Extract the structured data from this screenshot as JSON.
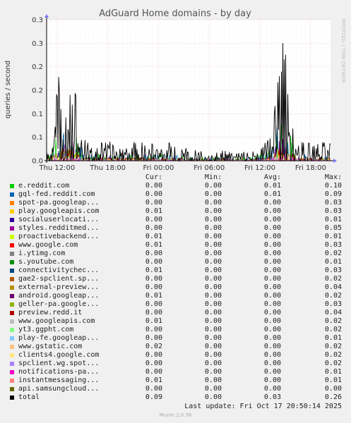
{
  "chart_data": {
    "type": "line",
    "title": "AdGuard Home domains - by day",
    "ylabel": "queries / second",
    "xlabel": "",
    "side_label": "RRDTOOL / TOBI OETIKER",
    "ylim": [
      0,
      0.3
    ],
    "yticks": [
      "0.0",
      "0.1",
      "0.1",
      "0.2",
      "0.2",
      "0.3",
      "0.3"
    ],
    "x_tick_labels": [
      "Thu 12:00",
      "Thu 18:00",
      "Fri 00:00",
      "Fri 06:00",
      "Fri 12:00",
      "Fri 18:00"
    ],
    "grid": true,
    "legend_header": [
      "Cur:",
      "Min:",
      "Avg:",
      "Max:"
    ],
    "series": [
      {
        "name": "e.reddit.com",
        "color": "#00cc00",
        "cur": "0.00",
        "min": "0.00",
        "avg": "0.01",
        "max": "0.10"
      },
      {
        "name": "gql-fed.reddit.com",
        "color": "#0066b3",
        "cur": "0.00",
        "min": "0.00",
        "avg": "0.01",
        "max": "0.09"
      },
      {
        "name": "spot-pa.googleap...",
        "color": "#ff8000",
        "cur": "0.00",
        "min": "0.00",
        "avg": "0.00",
        "max": "0.03"
      },
      {
        "name": "play.googleapis.com",
        "color": "#ffcc00",
        "cur": "0.01",
        "min": "0.00",
        "avg": "0.00",
        "max": "0.03"
      },
      {
        "name": "socialuserlocati...",
        "color": "#330099",
        "cur": "0.00",
        "min": "0.00",
        "avg": "0.00",
        "max": "0.01"
      },
      {
        "name": "styles.redditmed...",
        "color": "#990099",
        "cur": "0.00",
        "min": "0.00",
        "avg": "0.00",
        "max": "0.05"
      },
      {
        "name": "proactivebackend...",
        "color": "#ccff00",
        "cur": "0.01",
        "min": "0.00",
        "avg": "0.00",
        "max": "0.01"
      },
      {
        "name": "www.google.com",
        "color": "#ff0000",
        "cur": "0.01",
        "min": "0.00",
        "avg": "0.00",
        "max": "0.03"
      },
      {
        "name": "i.ytimg.com",
        "color": "#808080",
        "cur": "0.00",
        "min": "0.00",
        "avg": "0.00",
        "max": "0.02"
      },
      {
        "name": "s.youtube.com",
        "color": "#008f00",
        "cur": "0.00",
        "min": "0.00",
        "avg": "0.00",
        "max": "0.01"
      },
      {
        "name": "connectivitychec...",
        "color": "#00487d",
        "cur": "0.01",
        "min": "0.00",
        "avg": "0.00",
        "max": "0.03"
      },
      {
        "name": "gae2-spclient.sp...",
        "color": "#b35a00",
        "cur": "0.00",
        "min": "0.00",
        "avg": "0.00",
        "max": "0.02"
      },
      {
        "name": "external-preview...",
        "color": "#b38f00",
        "cur": "0.00",
        "min": "0.00",
        "avg": "0.00",
        "max": "0.04"
      },
      {
        "name": "android.googleap...",
        "color": "#6b006b",
        "cur": "0.01",
        "min": "0.00",
        "avg": "0.00",
        "max": "0.02"
      },
      {
        "name": "geller-pa.google...",
        "color": "#8fb300",
        "cur": "0.00",
        "min": "0.00",
        "avg": "0.00",
        "max": "0.03"
      },
      {
        "name": "preview.redd.it",
        "color": "#b30000",
        "cur": "0.00",
        "min": "0.00",
        "avg": "0.00",
        "max": "0.04"
      },
      {
        "name": "www.googleapis.com",
        "color": "#bebebe",
        "cur": "0.01",
        "min": "0.00",
        "avg": "0.00",
        "max": "0.02"
      },
      {
        "name": "yt3.ggpht.com",
        "color": "#80ff80",
        "cur": "0.00",
        "min": "0.00",
        "avg": "0.00",
        "max": "0.02"
      },
      {
        "name": "play-fe.googleap...",
        "color": "#80c9ff",
        "cur": "0.00",
        "min": "0.00",
        "avg": "0.00",
        "max": "0.01"
      },
      {
        "name": "www.gstatic.com",
        "color": "#ffc080",
        "cur": "0.02",
        "min": "0.00",
        "avg": "0.00",
        "max": "0.02"
      },
      {
        "name": "clients4.google.com",
        "color": "#ffe680",
        "cur": "0.00",
        "min": "0.00",
        "avg": "0.00",
        "max": "0.02"
      },
      {
        "name": "spclient.wg.spot...",
        "color": "#aa80ff",
        "cur": "0.00",
        "min": "0.00",
        "avg": "0.00",
        "max": "0.02"
      },
      {
        "name": "notifications-pa...",
        "color": "#ee00cc",
        "cur": "0.00",
        "min": "0.00",
        "avg": "0.00",
        "max": "0.01"
      },
      {
        "name": "instantmessaging...",
        "color": "#ff8080",
        "cur": "0.01",
        "min": "0.00",
        "avg": "0.00",
        "max": "0.01"
      },
      {
        "name": "api.samsungcloud...",
        "color": "#666600",
        "cur": "0.00",
        "min": "0.00",
        "avg": "0.00",
        "max": "0.00"
      },
      {
        "name": "total",
        "color": "#000000",
        "cur": "0.09",
        "min": "0.00",
        "avg": "0.03",
        "max": "0.26"
      }
    ]
  },
  "footer": {
    "last_update": "Last update: Fri Oct 17 20:50:14 2025",
    "munin_version": "Munin 2.0.76"
  }
}
